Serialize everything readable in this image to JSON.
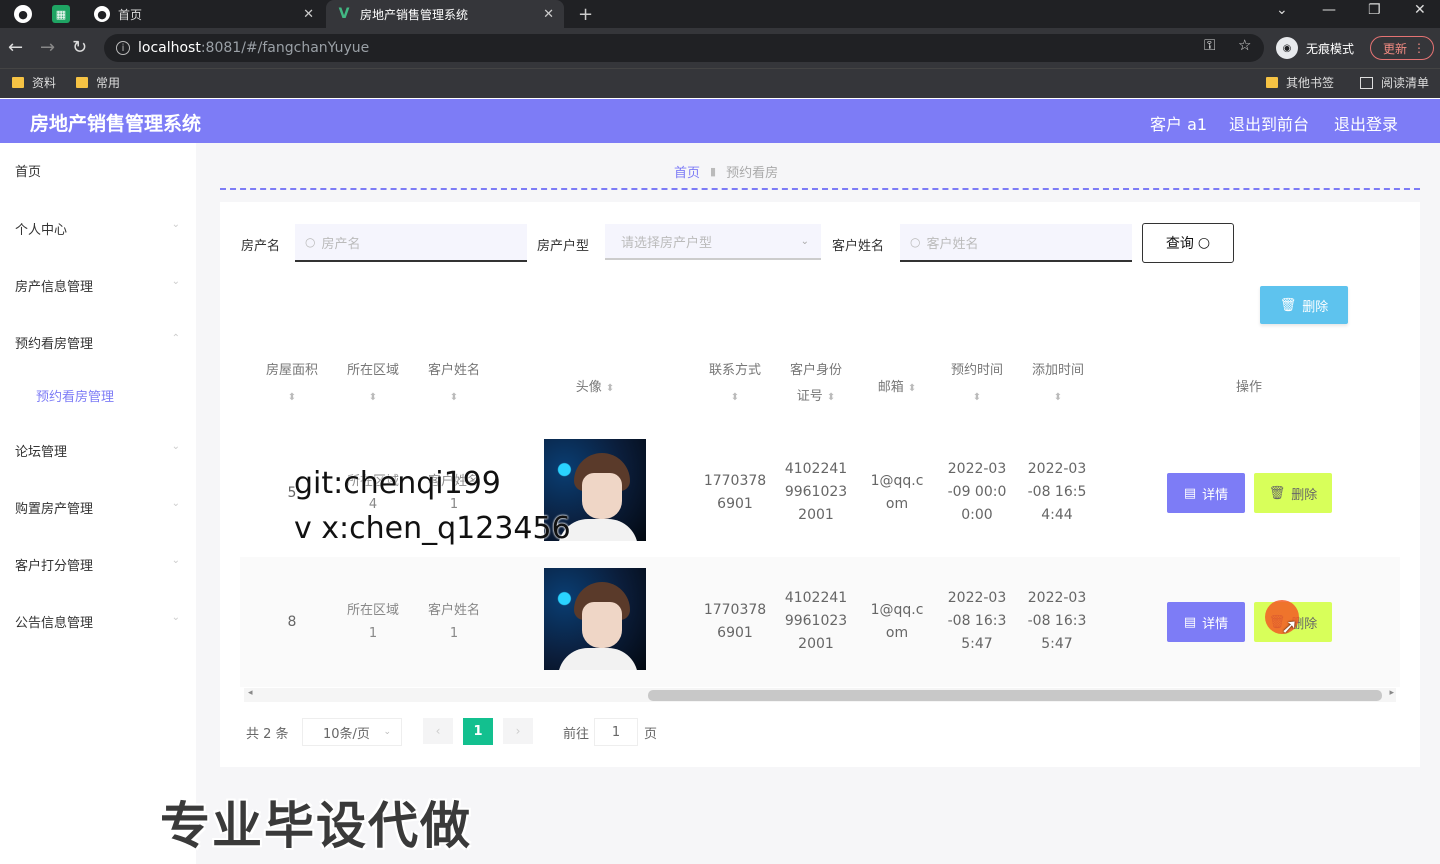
{
  "browser": {
    "tabs": [
      {
        "title": "首页",
        "active": false
      },
      {
        "title": "房地产销售管理系统",
        "active": true
      }
    ],
    "new_tab": "+",
    "url_host": "localhost",
    "url_rest": ":8081/#/fangchanYuyue",
    "incognito_label": "无痕模式",
    "update_label": "更新",
    "bookmarks": [
      "资料",
      "常用"
    ],
    "bookmarks_right": [
      "其他书签",
      "阅读清单"
    ]
  },
  "app": {
    "title": "房地产销售管理系统",
    "user_label": "客户 a1",
    "to_front": "退出到前台",
    "logout": "退出登录"
  },
  "sidebar": {
    "items": [
      "首页",
      "个人中心",
      "房产信息管理",
      "预约看房管理",
      "论坛管理",
      "购置房产管理",
      "客户打分管理",
      "公告信息管理"
    ],
    "sub_active": "预约看房管理"
  },
  "breadcrumb": {
    "home": "首页",
    "current": "预约看房"
  },
  "filters": {
    "name_label": "房产名",
    "name_placeholder": "房产名",
    "type_label": "房产户型",
    "type_placeholder": "请选择房产户型",
    "customer_label": "客户姓名",
    "customer_placeholder": "客户姓名",
    "query_btn": "查询"
  },
  "delete_btn": "删除",
  "table": {
    "headers": {
      "area": "房屋面积",
      "region": "所在区域",
      "customer": "客户姓名",
      "avatar": "头像",
      "phone": "联系方式",
      "idcard_1": "客户身份",
      "idcard_2": "证号",
      "email": "邮箱",
      "appoint_time": "预约时间",
      "add_time": "添加时间",
      "actions": "操作"
    },
    "rows": [
      {
        "area": "5",
        "region_1": "所在区域",
        "region_2": "4",
        "customer_1": "客户姓名",
        "customer_2": "1",
        "phone_1": "1770378",
        "phone_2": "6901",
        "id_1": "4102241",
        "id_2": "9961023",
        "id_3": "2001",
        "email_1": "1@qq.c",
        "email_2": "om",
        "appt_1": "2022-03",
        "appt_2": "-09 00:0",
        "appt_3": "0:00",
        "add_1": "2022-03",
        "add_2": "-08 16:5",
        "add_3": "4:44"
      },
      {
        "area": "8",
        "region_1": "所在区域",
        "region_2": "1",
        "customer_1": "客户姓名",
        "customer_2": "1",
        "phone_1": "1770378",
        "phone_2": "6901",
        "id_1": "4102241",
        "id_2": "9961023",
        "id_3": "2001",
        "email_1": "1@qq.c",
        "email_2": "om",
        "appt_1": "2022-03",
        "appt_2": "-08 16:3",
        "appt_3": "5:47",
        "add_1": "2022-03",
        "add_2": "-08 16:3",
        "add_3": "5:47"
      }
    ],
    "detail_btn": "详情",
    "delete_btn": "删除"
  },
  "pagination": {
    "total": "共 2 条",
    "page_size": "10条/页",
    "current": "1",
    "goto_label": "前往",
    "goto_value": "1",
    "page_suffix": "页"
  },
  "overlay": {
    "watermark_1": "git:chenqi199",
    "watermark_2": "v x:chen_q123456",
    "banner": "专业毕设代做"
  },
  "colors": {
    "primary": "#7d7cf6",
    "delete_top": "#5ec3ee",
    "delete_row": "#d8ff5a",
    "pager_active": "#13c08f"
  }
}
